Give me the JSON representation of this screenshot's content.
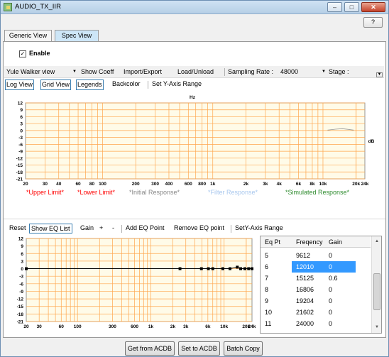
{
  "window": {
    "title": "AUDIO_TX_IIR",
    "help_label": "?",
    "min_symbol": "–",
    "max_symbol": "□",
    "close_symbol": "✕"
  },
  "tabs": [
    {
      "label": "Generic View",
      "active": false
    },
    {
      "label": "Spec View",
      "active": true
    }
  ],
  "enable": {
    "label": "Enable",
    "checked": true,
    "mark": "✓"
  },
  "toolbar1": {
    "view_select": "Yule Walker view",
    "show_coeff": "Show Coeff",
    "import_export": "Import/Export",
    "load_unload": "Load/Unload",
    "sampling_rate_label": "Sampling Rate :",
    "sampling_rate_value": "48000",
    "stage_label": "Stage :"
  },
  "toolbar2": {
    "log_view": "Log View",
    "grid_view": "Grid View",
    "legends": "Legends",
    "backcolor": "Backcolor",
    "set_y_axis_range": "Set Y-Axis Range"
  },
  "response_chart": {
    "x_unit": "Hz",
    "y_unit": "dB",
    "y_ticks": [
      "12",
      "9",
      "6",
      "3",
      "0",
      "-3",
      "-6",
      "-9",
      "-12",
      "-15",
      "-18",
      "-21"
    ],
    "x_ticks": [
      "20",
      "30",
      "40",
      "60",
      "80",
      "100",
      "200",
      "300",
      "400",
      "600",
      "800",
      "1k",
      "2k",
      "3k",
      "4k",
      "6k",
      "8k",
      "10k",
      "20k",
      "24k"
    ],
    "legend": [
      {
        "label": "*Upper Limit*",
        "color": "#ff0000"
      },
      {
        "label": "*Lower Limit*",
        "color": "#ff0000"
      },
      {
        "label": "*Initial Response*",
        "color": "#888888"
      },
      {
        "label": "*Filter Response*",
        "color": "#a9c8ee"
      },
      {
        "label": "*Simulated Response*",
        "color": "#2e8b2e"
      }
    ],
    "grid_color": "#ffa64d",
    "background": "#fffbe8"
  },
  "eq_toolbar": {
    "reset": "Reset",
    "show_eq_list": "Show EQ List",
    "gain": "Gain",
    "plus": "+",
    "minus": "-",
    "add_eq_point": "Add EQ Point",
    "remove_eq_point": "Remove EQ point",
    "set_y_axis_range": "SetY-Axis Range"
  },
  "eq_chart": {
    "y_ticks": [
      "12",
      "9",
      "6",
      "3",
      "0",
      "-3",
      "-6",
      "-9",
      "-12",
      "-15",
      "-18",
      "-21"
    ],
    "x_ticks": [
      "20",
      "30",
      "60",
      "100",
      "300",
      "600",
      "1k",
      "2k",
      "3k",
      "6k",
      "10k",
      "20k",
      "24k"
    ],
    "points_hz": [
      2500,
      4900,
      6100,
      7000,
      9612,
      12010,
      15125,
      16806,
      19204,
      21602,
      24000
    ],
    "points_gain": [
      0,
      0,
      0,
      0,
      0,
      0,
      0.6,
      0,
      0,
      0,
      0
    ]
  },
  "eq_list": {
    "headers": [
      "Eq Pt",
      "Freqency",
      "Gain"
    ],
    "rows": [
      {
        "pt": "5",
        "freq": "9612",
        "gain": "0",
        "selected": false
      },
      {
        "pt": "6",
        "freq": "12010",
        "gain": "0",
        "selected": true
      },
      {
        "pt": "7",
        "freq": "15125",
        "gain": "0.6",
        "selected": false
      },
      {
        "pt": "8",
        "freq": "16806",
        "gain": "0",
        "selected": false
      },
      {
        "pt": "9",
        "freq": "19204",
        "gain": "0",
        "selected": false
      },
      {
        "pt": "10",
        "freq": "21602",
        "gain": "0",
        "selected": false
      },
      {
        "pt": "11",
        "freq": "24000",
        "gain": "0",
        "selected": false
      }
    ]
  },
  "buttons": {
    "get_from_acdb": "Get from ACDB",
    "set_to_acdb": "Set to ACDB",
    "batch_copy": "Batch Copy"
  }
}
